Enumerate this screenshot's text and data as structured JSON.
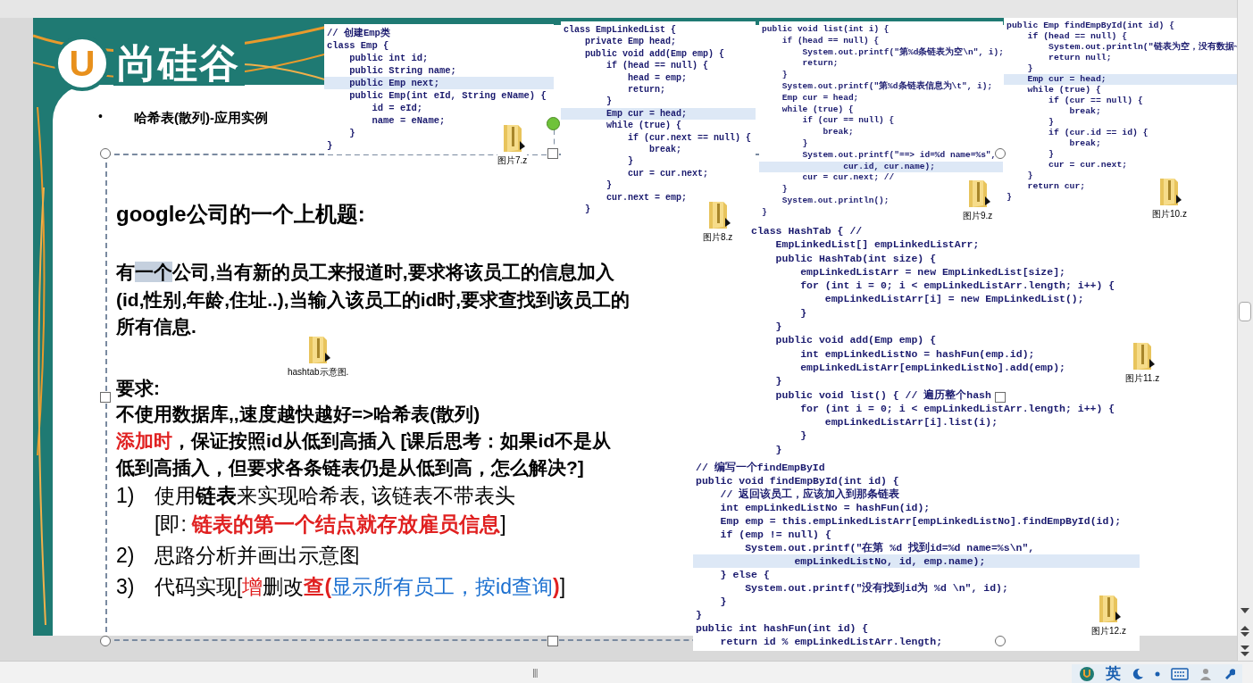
{
  "logo": {
    "mark": "U",
    "name": "尚硅谷"
  },
  "slide_heading": {
    "bullet": "•",
    "text": "哈希表(散列)-应用实例"
  },
  "code_snippets": [
    {
      "lines": [
        {
          "text": "// 创建Emp类",
          "highlighted": false
        },
        {
          "text": "class Emp {",
          "highlighted": false
        },
        {
          "text": "    public int id;",
          "highlighted": false
        },
        {
          "text": "    public String name;",
          "highlighted": false
        },
        {
          "text": "    public Emp next;",
          "highlighted": true
        },
        {
          "text": "    public Emp(int eId, String eName) {",
          "highlighted": false
        },
        {
          "text": "        id = eId;",
          "highlighted": false
        },
        {
          "text": "        name = eName;",
          "highlighted": false
        },
        {
          "text": "    }",
          "highlighted": false
        },
        {
          "text": "}",
          "highlighted": false
        }
      ]
    },
    {
      "lines": [
        {
          "text": "class EmpLinkedList {",
          "highlighted": false
        },
        {
          "text": "    private Emp head;",
          "highlighted": false
        },
        {
          "text": "    public void add(Emp emp) {",
          "highlighted": false
        },
        {
          "text": "        if (head == null) {",
          "highlighted": false
        },
        {
          "text": "            head = emp;",
          "highlighted": false
        },
        {
          "text": "            return;",
          "highlighted": false
        },
        {
          "text": "        }",
          "highlighted": false
        },
        {
          "text": "        Emp cur = head;",
          "highlighted": true
        },
        {
          "text": "        while (true) {",
          "highlighted": false
        },
        {
          "text": "            if (cur.next == null) {",
          "highlighted": false
        },
        {
          "text": "                break;",
          "highlighted": false
        },
        {
          "text": "            }",
          "highlighted": false
        },
        {
          "text": "            cur = cur.next;",
          "highlighted": false
        },
        {
          "text": "        }",
          "highlighted": false
        },
        {
          "text": "        cur.next = emp;",
          "highlighted": false
        },
        {
          "text": "    }",
          "highlighted": false
        }
      ]
    },
    {
      "lines": [
        {
          "text": "public void list(int i) {",
          "highlighted": false
        },
        {
          "text": "    if (head == null) {",
          "highlighted": false
        },
        {
          "text": "        System.out.printf(\"第%d条链表为空\\n\", i);",
          "highlighted": false
        },
        {
          "text": "        return;",
          "highlighted": false
        },
        {
          "text": "    }",
          "highlighted": false
        },
        {
          "text": "    System.out.printf(\"第%d条链表信息为\\t\", i);",
          "highlighted": false
        },
        {
          "text": "    Emp cur = head;",
          "highlighted": false
        },
        {
          "text": "    while (true) {",
          "highlighted": false
        },
        {
          "text": "        if (cur == null) {",
          "highlighted": false
        },
        {
          "text": "            break;",
          "highlighted": false
        },
        {
          "text": "        }",
          "highlighted": false
        },
        {
          "text": "        System.out.printf(\"==> id=%d name=%s\",",
          "highlighted": false
        },
        {
          "text": "                cur.id, cur.name);",
          "highlighted": true
        },
        {
          "text": "        cur = cur.next; //",
          "highlighted": false
        },
        {
          "text": "    }",
          "highlighted": false
        },
        {
          "text": "    System.out.println();",
          "highlighted": false
        },
        {
          "text": "}",
          "highlighted": false
        }
      ]
    },
    {
      "lines": [
        {
          "text": "public Emp findEmpById(int id) {",
          "highlighted": false
        },
        {
          "text": "    if (head == null) {",
          "highlighted": false
        },
        {
          "text": "        System.out.println(\"链表为空，没有数据~",
          "highlighted": false
        },
        {
          "text": "        return null;",
          "highlighted": false
        },
        {
          "text": "    }",
          "highlighted": false
        },
        {
          "text": "    Emp cur = head;",
          "highlighted": true
        },
        {
          "text": "    while (true) {",
          "highlighted": false
        },
        {
          "text": "        if (cur == null) {",
          "highlighted": false
        },
        {
          "text": "            break;",
          "highlighted": false
        },
        {
          "text": "        }",
          "highlighted": false
        },
        {
          "text": "        if (cur.id == id) {",
          "highlighted": false
        },
        {
          "text": "            break;",
          "highlighted": false
        },
        {
          "text": "        }",
          "highlighted": false
        },
        {
          "text": "        cur = cur.next;",
          "highlighted": false
        },
        {
          "text": "    }",
          "highlighted": false
        },
        {
          "text": "    return cur;",
          "highlighted": false
        },
        {
          "text": "}",
          "highlighted": false
        }
      ]
    },
    {
      "lines": [
        {
          "text": "class HashTab { //",
          "highlighted": false
        },
        {
          "text": "    EmpLinkedList[] empLinkedListArr;",
          "highlighted": false
        },
        {
          "text": "    public HashTab(int size) {",
          "highlighted": false
        },
        {
          "text": "        empLinkedListArr = new EmpLinkedList[size];",
          "highlighted": false
        },
        {
          "text": "        for (int i = 0; i < empLinkedListArr.length; i++) {",
          "highlighted": false
        },
        {
          "text": "            empLinkedListArr[i] = new EmpLinkedList();",
          "highlighted": false
        },
        {
          "text": "        }",
          "highlighted": false
        },
        {
          "text": "    }",
          "highlighted": false
        },
        {
          "text": "    public void add(Emp emp) {",
          "highlighted": false
        },
        {
          "text": "        int empLinkedListNo = hashFun(emp.id);",
          "highlighted": false
        },
        {
          "text": "        empLinkedListArr[empLinkedListNo].add(emp);",
          "highlighted": false
        },
        {
          "text": "    }",
          "highlighted": false
        },
        {
          "text": "    public void list() { // 遍历整个hash",
          "highlighted": false
        },
        {
          "text": "        for (int i = 0; i < empLinkedListArr.length; i++) {",
          "highlighted": false
        },
        {
          "text": "            empLinkedListArr[i].list(i);",
          "highlighted": false
        },
        {
          "text": "        }",
          "highlighted": false
        },
        {
          "text": "    }",
          "highlighted": false
        }
      ]
    },
    {
      "lines": [
        {
          "text": "// 编写一个findEmpById",
          "highlighted": false
        },
        {
          "text": "public void findEmpById(int id) {",
          "highlighted": false
        },
        {
          "text": "    // 返回该员工，应该加入到那条链表",
          "highlighted": false
        },
        {
          "text": "    int empLinkedListNo = hashFun(id);",
          "highlighted": false
        },
        {
          "text": "    Emp emp = this.empLinkedListArr[empLinkedListNo].findEmpById(id);",
          "highlighted": false
        },
        {
          "text": "    if (emp != null) {",
          "highlighted": false
        },
        {
          "text": "        System.out.printf(\"在第 %d 找到id=%d name=%s\\n\",",
          "highlighted": false
        },
        {
          "text": "                empLinkedListNo, id, emp.name);",
          "highlighted": true
        },
        {
          "text": "    } else {",
          "highlighted": false
        },
        {
          "text": "        System.out.printf(\"没有找到id为 %d \\n\", id);",
          "highlighted": false
        },
        {
          "text": "    }",
          "highlighted": false
        },
        {
          "text": "}",
          "highlighted": false
        },
        {
          "text": "public int hashFun(int id) {",
          "highlighted": false
        },
        {
          "text": "    return id % empLinkedListArr.length;",
          "highlighted": false
        }
      ]
    }
  ],
  "file_icons": [
    {
      "label": "图片7.z"
    },
    {
      "label": "图片8.z"
    },
    {
      "label": "图片9.z"
    },
    {
      "label": "图片10.z"
    },
    {
      "label": "图片11.z"
    },
    {
      "label": "图片12.z"
    },
    {
      "label": "hashtab示意图."
    }
  ],
  "title": "google公司的一个上机题:",
  "paragraph_lines": [
    {
      "runs": [
        {
          "text": "有",
          "color": "#000000",
          "highlighted": false
        },
        {
          "text": "一个",
          "color": "#000000",
          "highlighted": true
        },
        {
          "text": "公司,当有新的员工来报道时,要求将该员工的信息加入",
          "color": "#000000",
          "highlighted": false
        }
      ]
    },
    {
      "runs": [
        {
          "text": "(id,性别,年龄,住址..),当输入该员工的id时,要求查找到该员工的",
          "color": "#000000"
        }
      ]
    },
    {
      "runs": [
        {
          "text": "所有信息.",
          "color": "#000000"
        }
      ]
    },
    {
      "runs": [
        {
          "text": "要求:",
          "color": "#000000"
        }
      ]
    },
    {
      "runs": [
        {
          "text": "不使用数据库,,速度越快越好=>哈希表(散列)",
          "color": "#000000"
        }
      ]
    },
    {
      "runs": [
        {
          "text": "添加时",
          "color": "#e02020"
        },
        {
          "text": "，保证按照id从低到高插入 [课后思考：如果id不是从",
          "color": "#000000"
        }
      ]
    },
    {
      "runs": [
        {
          "text": "低到高插入，但要求各条链表仍是从低到高，怎么解决?]",
          "color": "#000000"
        }
      ]
    }
  ],
  "steps": [
    {
      "number": "1)",
      "lines": [
        {
          "runs": [
            {
              "text": "使用**链表**来实现哈希表, 该链表不带表头",
              "color": "#000000"
            }
          ]
        },
        {
          "runs": [
            {
              "text": "[即: ",
              "color": "#000000"
            },
            {
              "text": "**链表的第一个结点就存放雇员信息**",
              "color": "#e02020"
            },
            {
              "text": "]",
              "color": "#000000"
            }
          ]
        }
      ]
    },
    {
      "number": "2)",
      "lines": [
        {
          "runs": [
            {
              "text": "思路分析并画出示意图",
              "color": "#000000"
            }
          ]
        }
      ]
    },
    {
      "number": "3)",
      "lines": [
        {
          "runs": [
            {
              "text": "代码实现[",
              "color": "#000000"
            },
            {
              "text": "增",
              "color": "#e02020"
            },
            {
              "text": "删改",
              "color": "#000000"
            },
            {
              "text": "**查(**",
              "color": "#e02020"
            },
            {
              "text": "显示所有员工，按id查询",
              "color": "#1a6fd0"
            },
            {
              "text": "**)**",
              "color": "#e02020"
            },
            {
              "text": "]",
              "color": "#000000"
            }
          ]
        }
      ]
    }
  ],
  "status_bar": {
    "grip": "|||",
    "ime": "英"
  }
}
